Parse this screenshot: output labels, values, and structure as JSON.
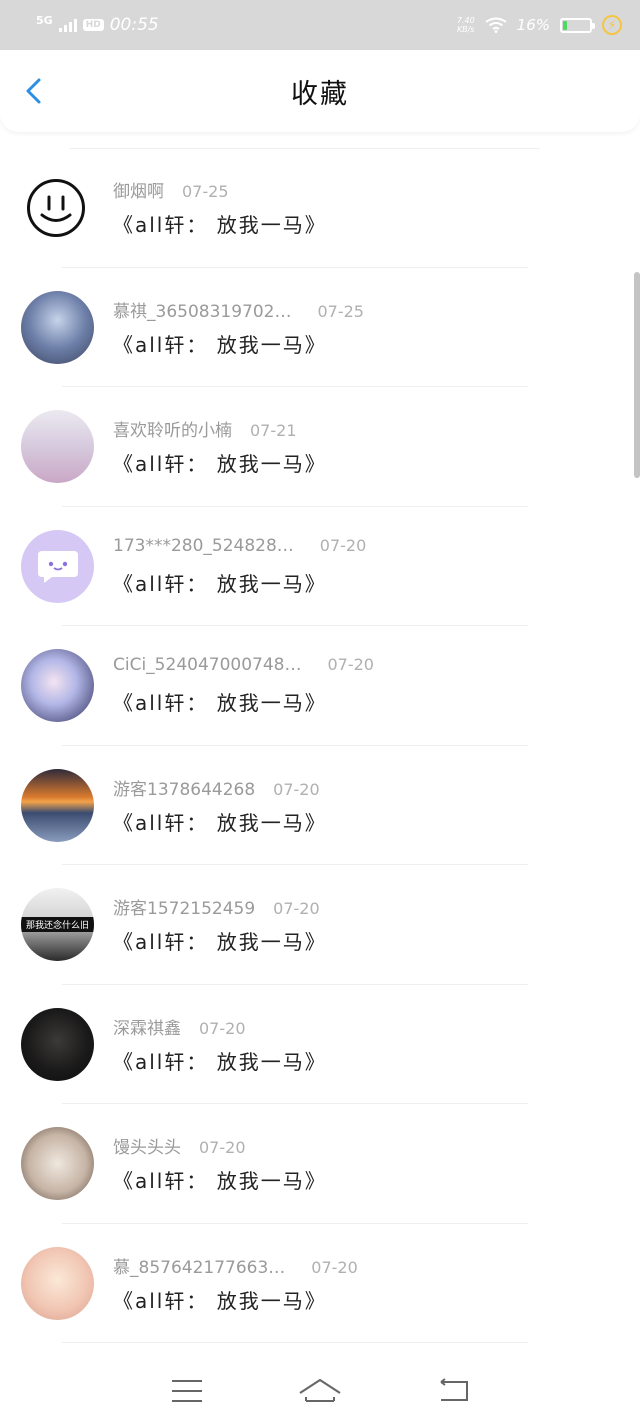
{
  "status_bar": {
    "network": "5G",
    "hd": "HD",
    "time": "00:55",
    "speed_value": "7.40",
    "speed_unit": "KB/s",
    "battery_percent": "16%",
    "battery_level": 0.16,
    "battery_color": "#4cd964"
  },
  "header": {
    "back_icon": "chevron-left-icon",
    "title": "收藏",
    "accent": "#2b8fe6"
  },
  "items": [
    {
      "user": "御烟啊",
      "date": "07-25",
      "title": "《all轩： 放我一马》",
      "avatar": "smiley-avatar"
    },
    {
      "user": "慕祺_36508319702…",
      "date": "07-25",
      "title": "《all轩： 放我一马》",
      "avatar": "photo-avatar"
    },
    {
      "user": "喜欢聆听的小楠",
      "date": "07-21",
      "title": "《all轩： 放我一马》",
      "avatar": "photo-avatar"
    },
    {
      "user": "173***280_524828…",
      "date": "07-20",
      "title": "《all轩： 放我一马》",
      "avatar": "chat-bubble-avatar"
    },
    {
      "user": "CiCi_524047000748…",
      "date": "07-20",
      "title": "《all轩： 放我一马》",
      "avatar": "anime-avatar"
    },
    {
      "user": "游客1378644268",
      "date": "07-20",
      "title": "《all轩： 放我一马》",
      "avatar": "sunset-avatar"
    },
    {
      "user": "游客1572152459",
      "date": "07-20",
      "title": "《all轩： 放我一马》",
      "avatar": "photo-avatar",
      "avatar_caption": "那我还念什么旧"
    },
    {
      "user": "深霖祺鑫",
      "date": "07-20",
      "title": "《all轩： 放我一马》",
      "avatar": "photo-avatar"
    },
    {
      "user": "馒头头头",
      "date": "07-20",
      "title": "《all轩： 放我一马》",
      "avatar": "photo-avatar"
    },
    {
      "user": "慕_857642177663…",
      "date": "07-20",
      "title": "《all轩： 放我一马》",
      "avatar": "anime-avatar"
    }
  ],
  "nav_bar": {
    "menu_icon": "menu-icon",
    "home_icon": "home-icon",
    "back_icon": "back-icon"
  }
}
